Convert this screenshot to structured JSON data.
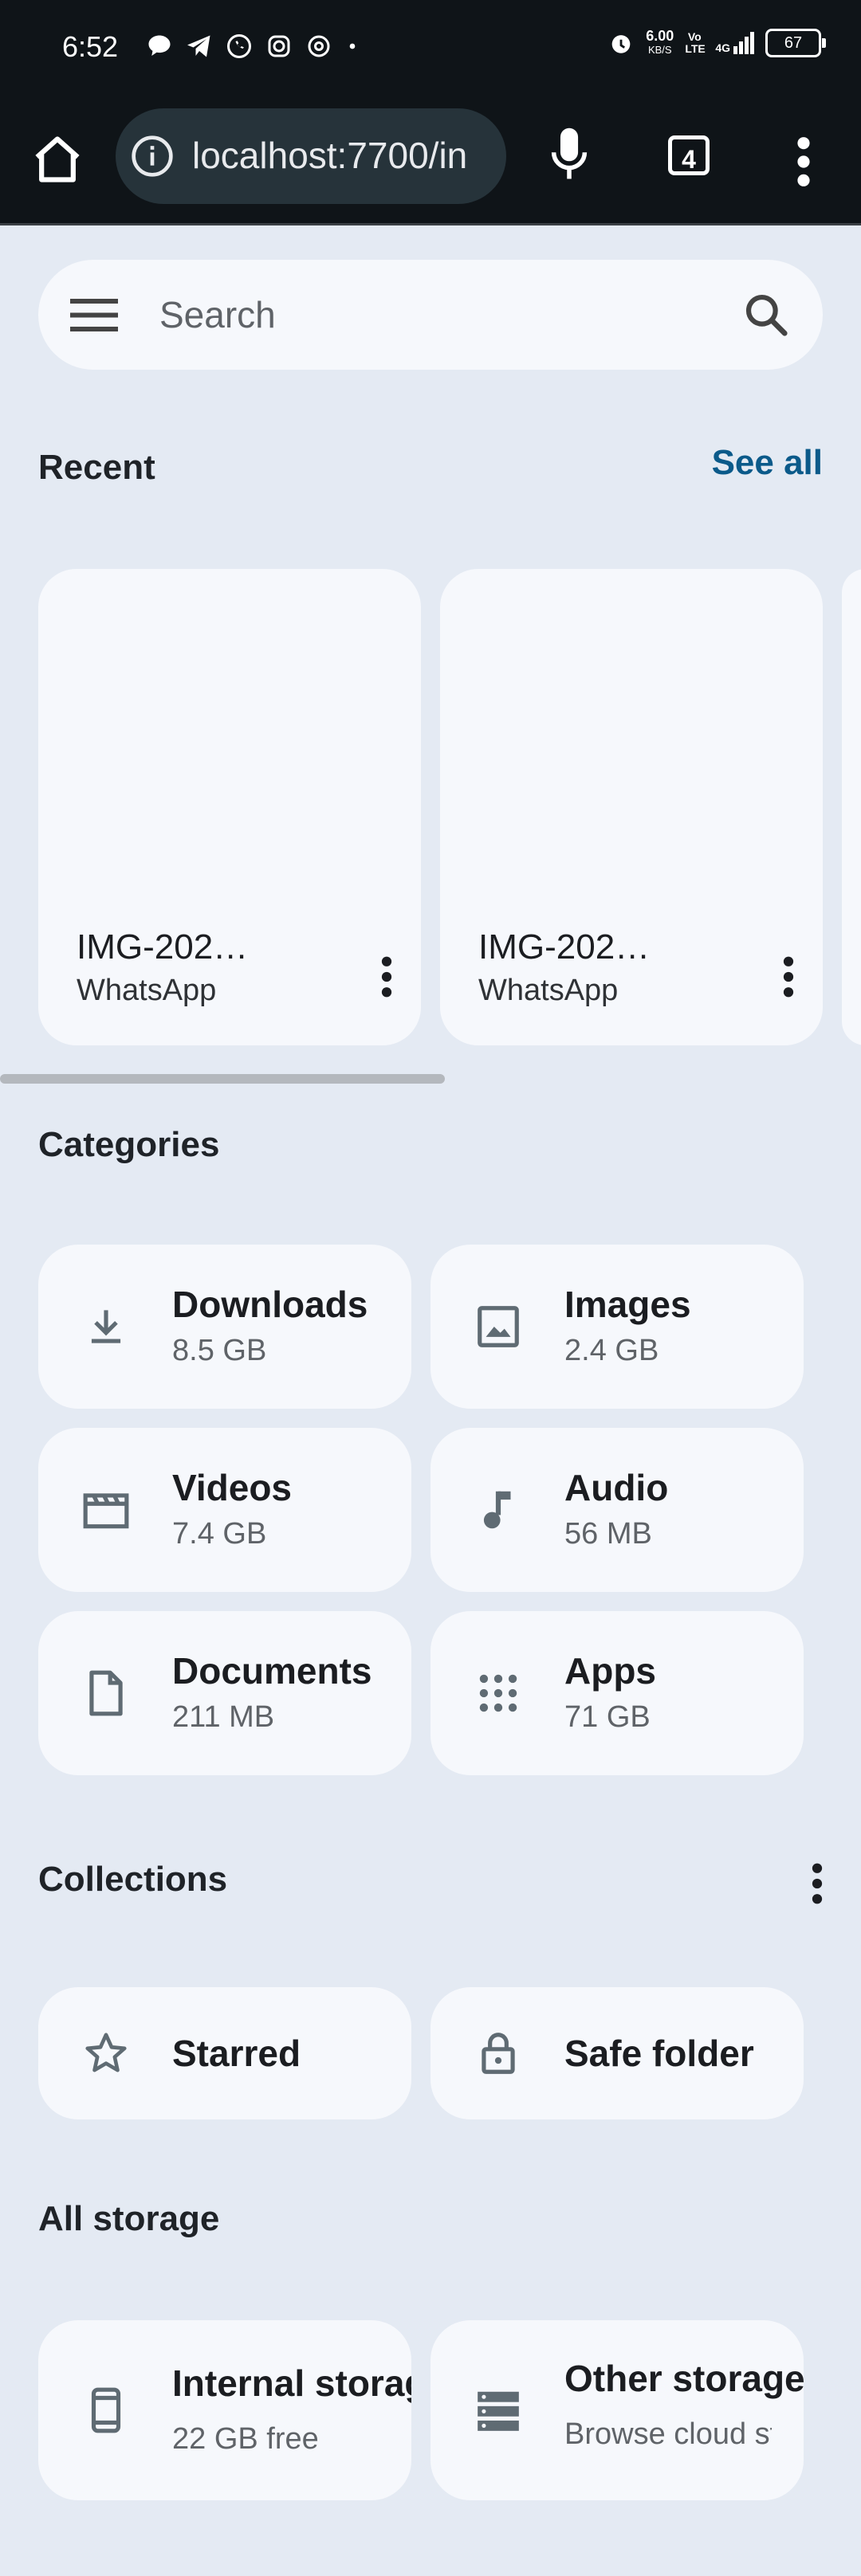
{
  "status_bar": {
    "time": "6:52",
    "speed_value": "6.00",
    "speed_unit": "KB/S",
    "volte": "Vo LTE",
    "network": "4G",
    "battery": "67"
  },
  "browser": {
    "url": "localhost:7700/in",
    "tab_count": "4"
  },
  "search": {
    "placeholder": "Search"
  },
  "recent": {
    "title": "Recent",
    "see_all": "See all",
    "items": [
      {
        "name": "IMG-202…",
        "source": "WhatsApp"
      },
      {
        "name": "IMG-202…",
        "source": "WhatsApp"
      }
    ]
  },
  "categories": {
    "title": "Categories",
    "items": [
      {
        "label": "Downloads",
        "size": "8.5 GB",
        "icon": "download-icon"
      },
      {
        "label": "Images",
        "size": "2.4 GB",
        "icon": "image-icon"
      },
      {
        "label": "Videos",
        "size": "7.4 GB",
        "icon": "video-icon"
      },
      {
        "label": "Audio",
        "size": "56 MB",
        "icon": "music-note-icon"
      },
      {
        "label": "Documents",
        "size": "211 MB",
        "icon": "document-icon"
      },
      {
        "label": "Apps",
        "size": "71 GB",
        "icon": "apps-grid-icon"
      }
    ]
  },
  "collections": {
    "title": "Collections",
    "items": [
      {
        "label": "Starred",
        "icon": "star-icon"
      },
      {
        "label": "Safe folder",
        "icon": "lock-icon"
      }
    ]
  },
  "storage": {
    "title": "All storage",
    "items": [
      {
        "label": "Internal storage",
        "sub": "22 GB free",
        "icon": "phone-icon"
      },
      {
        "label": "Other storage",
        "sub": "Browse cloud storage",
        "icon": "storage-list-icon"
      }
    ]
  },
  "colors": {
    "background": "#e4eaf3",
    "card": "#f6f8fc",
    "accent": "#0b5a8a",
    "chrome": "#0f1418"
  }
}
